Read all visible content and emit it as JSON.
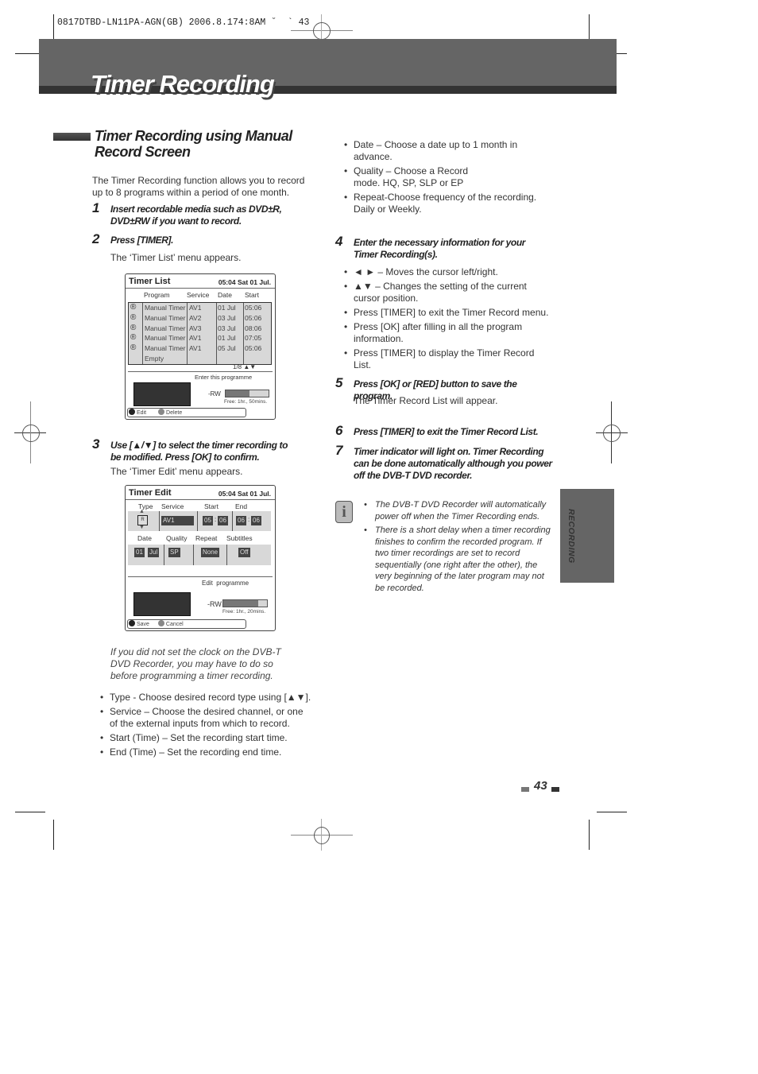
{
  "print_slug": "0817DTBD-LN11PA-AGN(GB) 2006.8.174:8AM ˘  ` 43",
  "page_title": "Timer Recording",
  "section_title": "Timer Recording using Manual Record Screen",
  "intro": "The Timer Recording function allows you to record up to 8 programs within a period of one month.",
  "steps": [
    {
      "num": "1",
      "text": "Insert recordable media such as DVD±R, DVD±RW if you want to record."
    },
    {
      "num": "2",
      "text": "Press [TIMER].",
      "sub": "The ‘Timer List’ menu appears."
    },
    {
      "num": "3",
      "text": "Use [▲/▼] to select the timer recording to be modified. Press [OK] to confirm.",
      "sub": "The ‘Timer Edit’ menu appears."
    },
    {
      "num": "4",
      "text": "Enter the necessary information for your Timer Recording(s)."
    },
    {
      "num": "5",
      "text": "Press [OK] or [RED] button to save the program.",
      "sub": "The Timer Record List will appear."
    },
    {
      "num": "6",
      "text": "Press [TIMER] to exit the Timer Record List."
    },
    {
      "num": "7",
      "text": "Timer indicator will light on. Timer Recording can be done automatically although you power off the DVB-T DVD recorder."
    }
  ],
  "timer_list": {
    "title": "Timer List",
    "clock": "05:04 Sat 01 Jul.",
    "headers": [
      "Program",
      "Service",
      "Date",
      "Start"
    ],
    "rows": [
      {
        "icon": "®",
        "program": "Manual Timer",
        "service": "AV1",
        "date": "01 Jul",
        "start": "05:06"
      },
      {
        "icon": "®",
        "program": "Manual Timer",
        "service": "AV2",
        "date": "03 Jul",
        "start": "05:06"
      },
      {
        "icon": "®",
        "program": "Manual Timer",
        "service": "AV3",
        "date": "03 Jul",
        "start": "08:06"
      },
      {
        "icon": "®",
        "program": "Manual Timer",
        "service": "AV1",
        "date": "01 Jul",
        "start": "07:05"
      },
      {
        "icon": "®",
        "program": "Manual Timer",
        "service": "AV1",
        "date": "05 Jul",
        "start": "05:06"
      },
      {
        "icon": "",
        "program": "Empty",
        "service": "",
        "date": "",
        "start": ""
      }
    ],
    "pager": "1/8 ▲▼",
    "hint": "Enter this programme",
    "disc": "-RW",
    "used_fraction": 0.55,
    "free": "Free: 1hr., 50mins.",
    "buttons": [
      "Edit",
      "Delete"
    ]
  },
  "timer_edit": {
    "title": "Timer Edit",
    "clock": "05:04 Sat 01 Jul.",
    "headers_top": [
      "Type",
      "Service",
      "Start",
      "End"
    ],
    "type": "R",
    "service": "AV1",
    "start_h": "05",
    "start_m": "06",
    "end_h": "06",
    "end_m": "06",
    "headers_bottom": [
      "Date",
      "Quality",
      "Repeat",
      "Subtitles"
    ],
    "date_d": "01",
    "date_m": "Jul",
    "quality": "SP",
    "repeat": "None",
    "subtitles": "Off",
    "hint": "Edit  programme",
    "disc": "-RW",
    "used_fraction": 0.8,
    "free": "Free: 1hr., 20mins.",
    "buttons": [
      "Save",
      "Cancel"
    ]
  },
  "clock_note": "If you did not set the clock on the DVB-T DVD Recorder, you may have to do so before programming a timer recording.",
  "field_bullets": [
    "Type - Choose desired record type using [▲▼].",
    "Service – Choose the desired channel, or one of the external inputs from which to record.",
    "Start (Time) – Set the recording start time.",
    "End (Time) – Set the recording end time."
  ],
  "field_bullets_right": [
    "Date – Choose a date up to 1 month in advance.",
    "Quality – Choose a Record mode. HQ, SP, SLP or EP",
    "Repeat-Choose frequency of the recording. Daily or Weekly."
  ],
  "step4_bullets": [
    "◄ ►  – Moves the cursor left/right.",
    "▲▼  – Changes the setting of the current cursor position.",
    "Press [TIMER] to exit the Timer Record menu.",
    "Press [OK] after filling in all the program information.",
    "Press [TIMER] to display the Timer Record List."
  ],
  "notes": [
    "The DVB-T DVD Recorder will automatically power off when the Timer Recording ends.",
    "There is a short delay when a timer recording finishes to confirm the recorded program. If two timer recordings are set to record sequentially (one right after the other), the very beginning of the later program may not be recorded."
  ],
  "side_tab": "RECORDING",
  "page_number": "43"
}
